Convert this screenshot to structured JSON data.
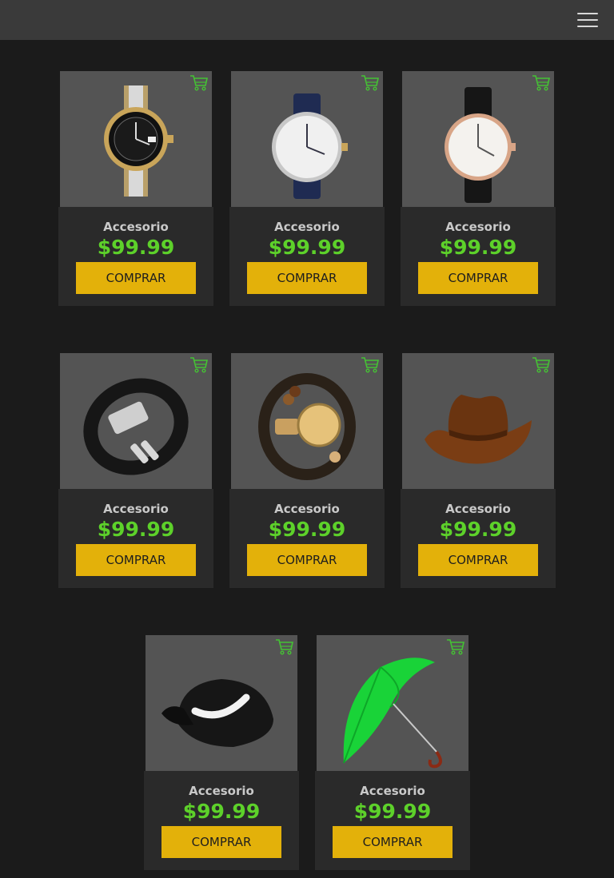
{
  "header": {
    "menu_icon": "hamburger-menu-icon"
  },
  "products": [
    {
      "name": "Accesorio",
      "price": "$99.99",
      "button": "COMPRAR",
      "image": "gold-steel-watch"
    },
    {
      "name": "Accesorio",
      "price": "$99.99",
      "button": "COMPRAR",
      "image": "blue-strap-watch"
    },
    {
      "name": "Accesorio",
      "price": "$99.99",
      "button": "COMPRAR",
      "image": "leather-dress-watch"
    },
    {
      "name": "Accesorio",
      "price": "$99.99",
      "button": "COMPRAR",
      "image": "leather-bracelet"
    },
    {
      "name": "Accesorio",
      "price": "$99.99",
      "button": "COMPRAR",
      "image": "scorpio-bracelet"
    },
    {
      "name": "Accesorio",
      "price": "$99.99",
      "button": "COMPRAR",
      "image": "cowboy-hat"
    },
    {
      "name": "Accesorio",
      "price": "$99.99",
      "button": "COMPRAR",
      "image": "nike-cap"
    },
    {
      "name": "Accesorio",
      "price": "$99.99",
      "button": "COMPRAR",
      "image": "green-umbrella"
    }
  ],
  "colors": {
    "background": "#1b1b1b",
    "header": "#3a3a3a",
    "card_image_bg": "#545454",
    "card_info_bg": "#2a2a2a",
    "price": "#5dd12a",
    "button": "#e3b10a",
    "cart_icon": "#45c234"
  }
}
